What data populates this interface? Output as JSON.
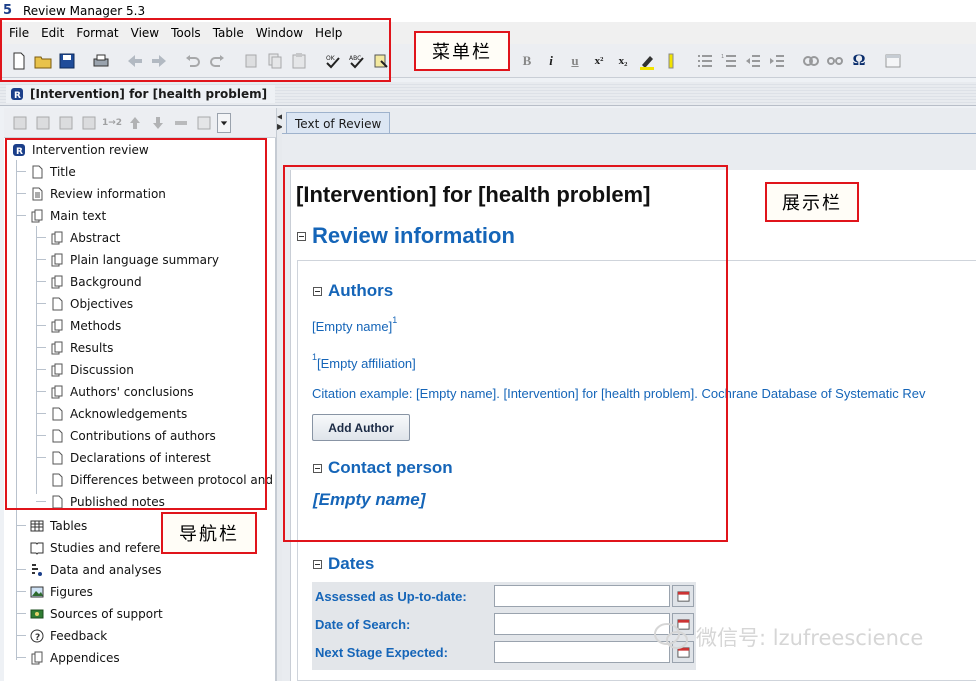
{
  "app": {
    "title": "Review Manager 5.3",
    "logo_text": "5"
  },
  "menu": [
    "File",
    "Edit",
    "Format",
    "View",
    "Tools",
    "Table",
    "Window",
    "Help"
  ],
  "document_tab": {
    "label": "[Intervention] for [health problem]"
  },
  "nav": {
    "tree": [
      {
        "label": "Intervention review",
        "icon": "review-root-icon",
        "level": 0
      },
      {
        "label": "Title",
        "icon": "page-icon",
        "level": 1
      },
      {
        "label": "Review information",
        "icon": "page-icon",
        "level": 1
      },
      {
        "label": "Main text",
        "icon": "pages-icon",
        "level": 1
      },
      {
        "label": "Abstract",
        "icon": "pages-icon",
        "level": 2
      },
      {
        "label": "Plain language summary",
        "icon": "pages-icon",
        "level": 2
      },
      {
        "label": "Background",
        "icon": "pages-icon",
        "level": 2
      },
      {
        "label": "Objectives",
        "icon": "page-icon",
        "level": 2
      },
      {
        "label": "Methods",
        "icon": "pages-icon",
        "level": 2
      },
      {
        "label": "Results",
        "icon": "pages-icon",
        "level": 2
      },
      {
        "label": "Discussion",
        "icon": "pages-icon",
        "level": 2
      },
      {
        "label": "Authors' conclusions",
        "icon": "pages-icon",
        "level": 2
      },
      {
        "label": "Acknowledgements",
        "icon": "page-icon",
        "level": 2
      },
      {
        "label": "Contributions of authors",
        "icon": "page-icon",
        "level": 2
      },
      {
        "label": "Declarations of interest",
        "icon": "page-icon",
        "level": 2
      },
      {
        "label": "Differences between protocol and re",
        "icon": "page-icon",
        "level": 2
      },
      {
        "label": "Published notes",
        "icon": "page-icon",
        "level": 2
      },
      {
        "label": "Tables",
        "icon": "table-icon",
        "level": 1
      },
      {
        "label": "Studies and referenc",
        "icon": "book-icon",
        "level": 1
      },
      {
        "label": "Data and analyses",
        "icon": "data-icon",
        "level": 1
      },
      {
        "label": "Figures",
        "icon": "image-icon",
        "level": 1
      },
      {
        "label": "Sources of support",
        "icon": "support-icon",
        "level": 1
      },
      {
        "label": "Feedback",
        "icon": "feedback-icon",
        "level": 1
      },
      {
        "label": "Appendices",
        "icon": "pages-icon",
        "level": 1
      }
    ]
  },
  "right_tab": {
    "label": "Text of Review"
  },
  "review": {
    "title": "[Intervention] for [health problem]",
    "review_info_heading": "Review information",
    "authors_heading": "Authors",
    "author_empty_name": "[Empty name]",
    "author_sup": "1",
    "affiliation_sup": "1",
    "affiliation_empty": "[Empty affiliation]",
    "citation_example": "Citation example: [Empty name]. [Intervention] for [health problem]. Cochrane Database of Systematic Rev",
    "add_author_label": "Add Author",
    "contact_heading": "Contact person",
    "contact_empty_name": "[Empty name]",
    "dates_heading": "Dates",
    "dates": [
      {
        "label": "Assessed as Up-to-date:",
        "value": ""
      },
      {
        "label": "Date of Search:",
        "value": ""
      },
      {
        "label": "Next Stage Expected:",
        "value": ""
      }
    ]
  },
  "annotations": {
    "menu_label": "菜单栏",
    "nav_label": "导航栏",
    "display_label": "展示栏"
  },
  "watermark": "微信号: lzufreescience",
  "colors": {
    "heading_blue": "#1565b8",
    "callout_red": "#e0141b"
  }
}
